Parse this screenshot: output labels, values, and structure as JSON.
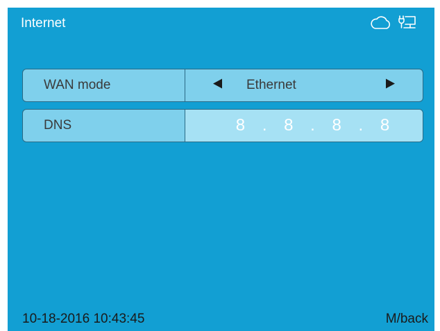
{
  "header": {
    "title": "Internet",
    "icons": [
      "cloud-icon",
      "ethernet-plug-icon"
    ]
  },
  "settings": {
    "wan": {
      "label": "WAN mode",
      "value": "Ethernet"
    },
    "dns": {
      "label": "DNS",
      "value": "8 . 8 . 8 . 8"
    }
  },
  "footer": {
    "datetime": "10-18-2016 10:43:45",
    "back_label": "M/back"
  },
  "colors": {
    "background": "#129fd3",
    "row": "#7fd0ec",
    "dns_field": "#a6e1f4"
  }
}
